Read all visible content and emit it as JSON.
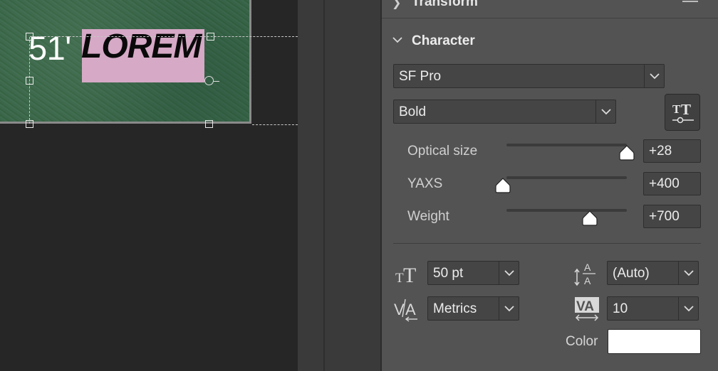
{
  "canvas": {
    "number_text": "51'",
    "word_text": "LOREM",
    "highlight_color": "#d6a9c6"
  },
  "panel": {
    "transform_section": {
      "label": "Transform",
      "icon": "chevron-right-icon"
    },
    "character_section": {
      "label": "Character",
      "font_family": "SF Pro",
      "font_style": "Bold",
      "variable_font_button_icon": "variable-font-axes-icon",
      "sliders": [
        {
          "label": "Optical size",
          "value": "+28",
          "position": 0.99
        },
        {
          "label": "YAXS",
          "value": "+400",
          "position": 0.0
        },
        {
          "label": "Weight",
          "value": "+700",
          "position": 0.7
        }
      ],
      "font_size": "50 pt",
      "leading": "(Auto)",
      "kerning": "Metrics",
      "tracking": "10",
      "color_label": "Color",
      "color_value": "#ffffff"
    }
  }
}
